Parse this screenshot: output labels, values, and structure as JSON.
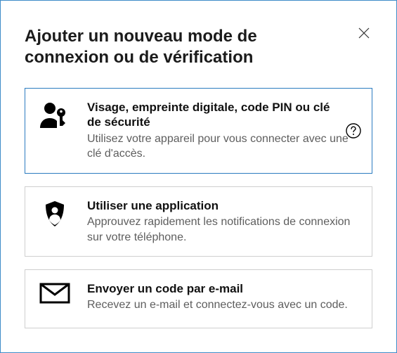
{
  "header": {
    "title": "Ajouter un nouveau mode de connexion ou de vérification"
  },
  "options": [
    {
      "title": "Visage, empreinte digitale, code PIN ou clé de sécurité",
      "desc": "Utilisez votre appareil pour vous connecter avec une clé d'accès."
    },
    {
      "title": "Utiliser une application",
      "desc": "Approuvez rapidement les notifications de connexion sur votre téléphone."
    },
    {
      "title": "Envoyer un code par e-mail",
      "desc": "Recevez un e-mail et connectez-vous avec un code."
    }
  ]
}
